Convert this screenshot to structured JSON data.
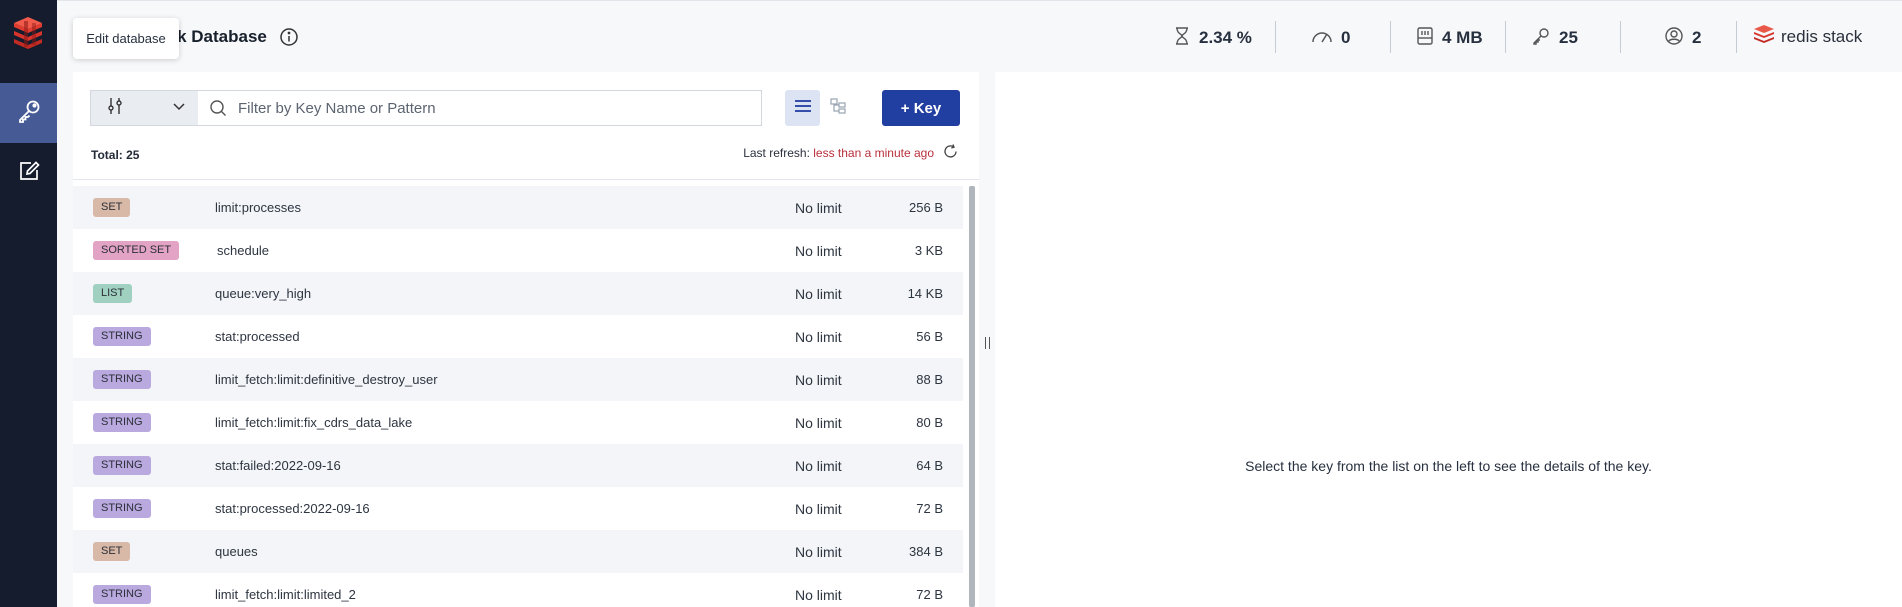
{
  "tooltip": {
    "text": "Edit database"
  },
  "header": {
    "db_name": "s Stack Database",
    "metrics": {
      "cpu": "2.34 %",
      "ops": "0",
      "memory": "4 MB",
      "keys": "25",
      "clients": "2"
    },
    "brand": "redis stack"
  },
  "filter": {
    "placeholder": "Filter by Key Name or Pattern",
    "add_key_label": "+ Key"
  },
  "list_meta": {
    "total": "Total: 25",
    "last_refresh_label": "Last refresh:",
    "last_refresh_value": "less than a minute ago"
  },
  "keys": [
    {
      "type": "SET",
      "name": "limit:processes",
      "ttl": "No limit",
      "size": "256 B"
    },
    {
      "type": "SORTED SET",
      "name": "schedule",
      "ttl": "No limit",
      "size": "3 KB"
    },
    {
      "type": "LIST",
      "name": "queue:very_high",
      "ttl": "No limit",
      "size": "14 KB"
    },
    {
      "type": "STRING",
      "name": "stat:processed",
      "ttl": "No limit",
      "size": "56 B"
    },
    {
      "type": "STRING",
      "name": "limit_fetch:limit:definitive_destroy_user",
      "ttl": "No limit",
      "size": "88 B"
    },
    {
      "type": "STRING",
      "name": "limit_fetch:limit:fix_cdrs_data_lake",
      "ttl": "No limit",
      "size": "80 B"
    },
    {
      "type": "STRING",
      "name": "stat:failed:2022-09-16",
      "ttl": "No limit",
      "size": "64 B"
    },
    {
      "type": "STRING",
      "name": "stat:processed:2022-09-16",
      "ttl": "No limit",
      "size": "72 B"
    },
    {
      "type": "SET",
      "name": "queues",
      "ttl": "No limit",
      "size": "384 B"
    },
    {
      "type": "STRING",
      "name": "limit_fetch:limit:limited_2",
      "ttl": "No limit",
      "size": "72 B"
    }
  ],
  "detail": {
    "empty_message": "Select the key from the list on the left to see the details of the key."
  },
  "colors": {
    "sidebar": "#141c2e",
    "sidebar_active": "#465b96",
    "primary_button": "#213ea1",
    "refresh_time": "#b8303b",
    "badge_set": "#d8b8a6",
    "badge_sorted_set": "#e3a3c4",
    "badge_list": "#9fd0c0",
    "badge_string": "#b9a9df"
  },
  "icons": {
    "sidebar": [
      "redis-logo-icon",
      "key-icon",
      "edit-icon"
    ],
    "header": [
      "info-icon",
      "cpu-icon",
      "ops-gauge-icon",
      "memory-icon",
      "keys-icon",
      "clients-icon",
      "redis-stack-logo-icon",
      "kebab-menu-icon"
    ],
    "toolbar": [
      "filter-settings-icon",
      "chevron-down-icon",
      "search-icon",
      "list-view-icon",
      "tree-view-icon",
      "refresh-icon"
    ]
  }
}
